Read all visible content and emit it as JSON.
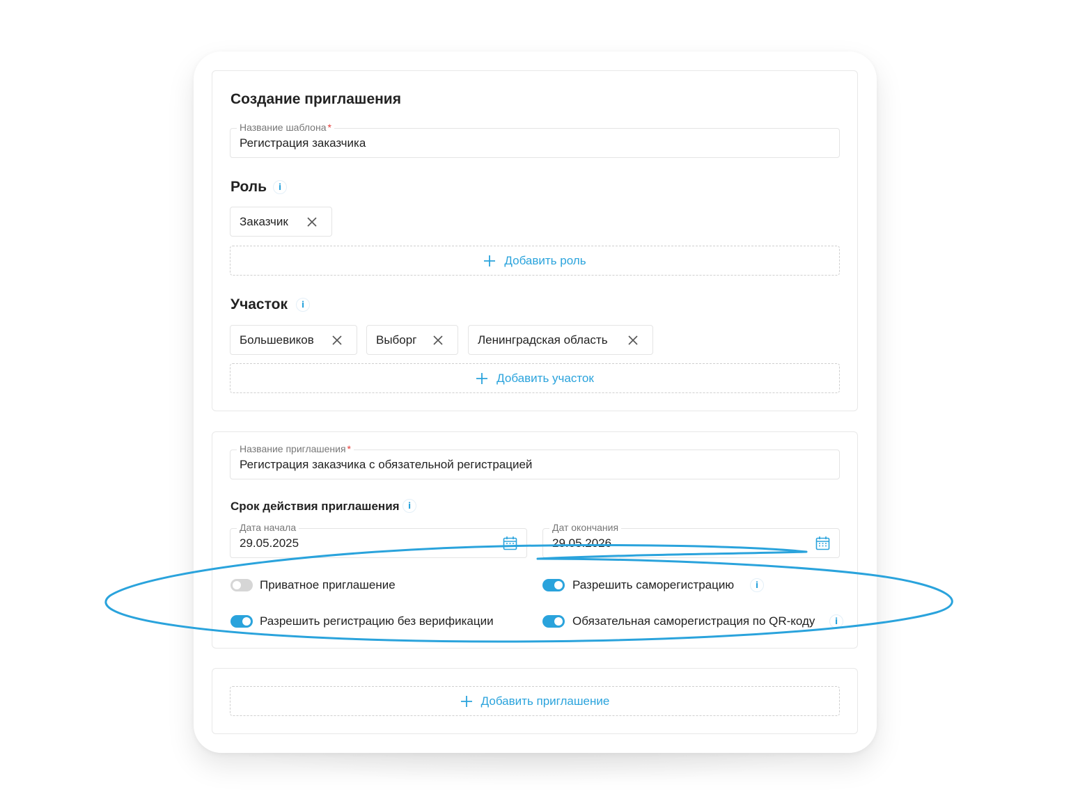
{
  "form": {
    "title": "Создание приглашения",
    "template_name": {
      "label": "Название шаблона",
      "required_mark": "*",
      "value": "Регистрация заказчика"
    },
    "role": {
      "heading": "Роль",
      "chips": [
        "Заказчик"
      ],
      "add_label": "Добавить роль"
    },
    "site": {
      "heading": "Участок",
      "chips": [
        "Большевиков",
        "Выборг",
        "Ленинградская область"
      ],
      "add_label": "Добавить участок"
    }
  },
  "invitation": {
    "name": {
      "label": "Название приглашения",
      "required_mark": "*",
      "value": "Регистрация заказчика с обязательной регистрацией"
    },
    "validity_heading": "Срок действия приглашения",
    "start_date": {
      "label": "Дата начала",
      "value": "29.05.2025"
    },
    "end_date": {
      "label": "Дат окончания",
      "value": "29.05.2026"
    },
    "toggles": [
      {
        "label": "Приватное приглашение",
        "on": false
      },
      {
        "label": "Разрешить саморегистрацию",
        "on": true
      },
      {
        "label": "Разрешить регистрацию без верификации",
        "on": true
      },
      {
        "label": "Обязательная саморегистрация по QR-коду",
        "on": true
      }
    ]
  },
  "footer": {
    "add_invitation_label": "Добавить приглашение"
  },
  "icons": {
    "info": "info-icon",
    "remove": "close-icon",
    "add": "plus-icon",
    "calendar": "calendar-icon",
    "info_glyph": "i"
  },
  "colors": {
    "accent": "#2aa3dc",
    "required": "#e53935",
    "toggle_off": "#d6d6d6"
  }
}
